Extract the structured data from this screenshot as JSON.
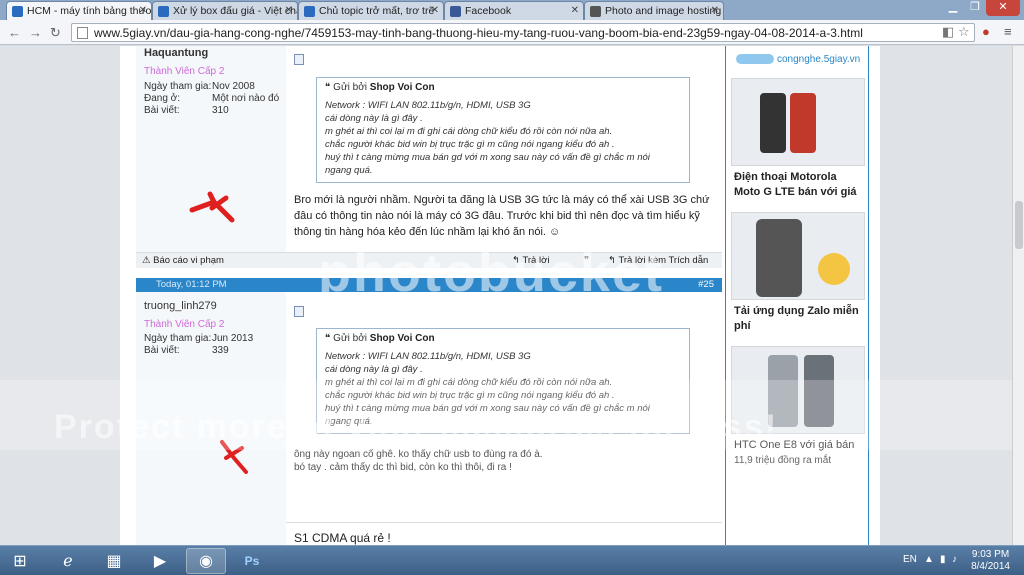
{
  "browser": {
    "tabs": [
      {
        "title": "HCM - máy tính bảng thương hi",
        "active": true,
        "color": "#2a6bbf"
      },
      {
        "title": "Xử lý box đấu giá - Việt chât",
        "active": false,
        "color": "#2a6bbf"
      },
      {
        "title": "Chủ topic trở mất, trơ trẽ",
        "active": false,
        "color": "#2a6bbf"
      },
      {
        "title": "Facebook",
        "active": false,
        "color": "#3b5998"
      },
      {
        "title": "Photo and image hosting",
        "active": false,
        "color": "#555555"
      }
    ],
    "url": "www.5giay.vn/dau-gia-hang-cong-nghe/7459153-may-tinh-bang-thuong-hieu-my-tang-ruou-vang-boom-bia-end-23g59-ngay-04-08-2014-a-3.html"
  },
  "posts": [
    {
      "username": "Haquantung",
      "rank": "Thành Viên Cấp 2",
      "join_label": "Ngày tham gia:",
      "join_value": "Nov 2008",
      "location_label": "Đang ở:",
      "location_value": "Một nơi nào đó",
      "posts_label": "Bài viết:",
      "posts_value": "310",
      "quote_by_label": "Gửi bởi",
      "quote_author": "Shop Voi Con",
      "quote_lines": [
        "Network : WIFI LAN 802.11b/g/n, HDMI, USB 3G",
        "cái dòng này là gì đây .",
        "m ghét ai thì coi lại m đi ghi cái dòng chữ kiểu đó rồi còn nói nữa ah.",
        "chắc người khác bid win bị trục trặc gì m cũng nói ngang kiểu đó ah .",
        "huý thì t càng mừng mua bán gd với m xong sau này có vấn đề gì chắc m nói",
        "ngang quá."
      ],
      "body_lines": [
        "Bro mới là người nhầm. Người ta đăng là USB 3G tức là máy có thể xài USB 3G chứ",
        "đâu có thông tin nào nói là máy có 3G đâu. Trước khi bid thì nên đọc và tìm hiểu kỹ",
        "thông tin hàng hóa kẻo đến lúc nhầm lại khó ăn nói."
      ],
      "report_label": "Báo cáo vi phạm",
      "reply_label": "Trả lời",
      "quote_reply_label": "Trả lời kèm Trích dẫn"
    },
    {
      "date": "Today, 01:12 PM",
      "number": "#25",
      "username": "truong_linh279",
      "rank": "Thành Viên Cấp 2",
      "join_label": "Ngày tham gia:",
      "join_value": "Jun 2013",
      "posts_label": "Bài viết:",
      "posts_value": "339",
      "quote_by_label": "Gửi bởi",
      "quote_author": "Shop Voi Con",
      "quote_lines": [
        "Network : WIFI LAN 802.11b/g/n, HDMI, USB 3G",
        "cái dòng này là gì đây .",
        "m ghét ai thì coi lại m đi ghi cái dòng chữ kiểu đó rồi còn nói nữa ah.",
        "chắc người khác bid win bị trục trặc gì m cũng nói ngang kiểu đó ah .",
        "huý thì t càng mừng mua bán gd với m xong sau này có vấn đề gì chắc m nói",
        "ngang quá."
      ],
      "body_lines": [
        "ông này ngoan cố ghê. ko thấy chữ usb to đùng ra đó à.",
        "bó tay . cảm thấy dc thì bid, còn ko thì thôi, đi ra !"
      ]
    }
  ],
  "next_post_title": "S1 CDMA quá rẻ !",
  "sidebar": {
    "logo_text": "congnghe.5giay.vn",
    "items": [
      {
        "title": "Điện thoại Motorola Moto G LTE bán với giá"
      },
      {
        "title": "Tải ứng dụng Zalo miễn phí"
      },
      {
        "title": "HTC One E8 với giá bán",
        "subtitle": "11,9 triệu đồng ra mắt"
      }
    ]
  },
  "watermark": "photobucket",
  "watermark_band": "Protect more of your memories for less!",
  "taskbar": {
    "lang": "EN",
    "time": "9:03 PM",
    "date": "8/4/2014"
  }
}
